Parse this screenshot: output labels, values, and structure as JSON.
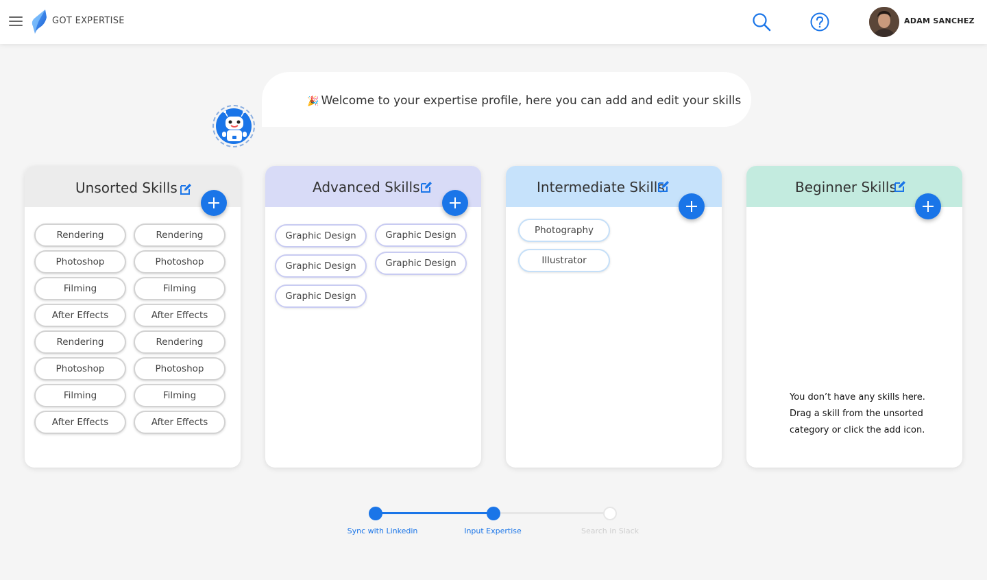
{
  "header": {
    "app_title": "GOT EXPERTISE",
    "user_name": "ADAM SANCHEZ",
    "icons": [
      "menu-icon",
      "logo-icon",
      "search-icon",
      "help-icon",
      "avatar"
    ]
  },
  "welcome": {
    "emoji": "🎉",
    "message": "Welcome to your expertise profile, here you can add and edit your skills"
  },
  "colors": {
    "accent": "#1a75e8",
    "unsorted_header": "#ececec",
    "advanced_header": "#d8dbf7",
    "intermediate_header": "#c6e2fb",
    "beginner_header": "#c3ebdf"
  },
  "columns": {
    "unsorted": {
      "title": "Unsorted Skills",
      "skills": [
        "Rendering",
        "Rendering",
        "Photoshop",
        "Photoshop",
        "Filming",
        "Filming",
        "After Effects",
        "After Effects",
        "Rendering",
        "Rendering",
        "Photoshop",
        "Photoshop",
        "Filming",
        "Filming",
        "After Effects",
        "After Effects"
      ]
    },
    "advanced": {
      "title": "Advanced Skills",
      "skills": [
        "Graphic Design",
        "Graphic Design",
        "Graphic Design",
        "Graphic Design",
        "Graphic Design"
      ]
    },
    "intermediate": {
      "title": "Intermediate Skills",
      "skills": [
        "Photography",
        "Illustrator"
      ]
    },
    "beginner": {
      "title": "Beginner Skills",
      "skills": [],
      "empty_message": "You don’t have any skills here. Drag a skill from the unsorted category or click the add icon."
    }
  },
  "stepper": {
    "steps": [
      {
        "label": "Sync with Linkedin",
        "state": "done"
      },
      {
        "label": "Input Expertise",
        "state": "current"
      },
      {
        "label": "Search in Slack",
        "state": "pending"
      }
    ]
  }
}
